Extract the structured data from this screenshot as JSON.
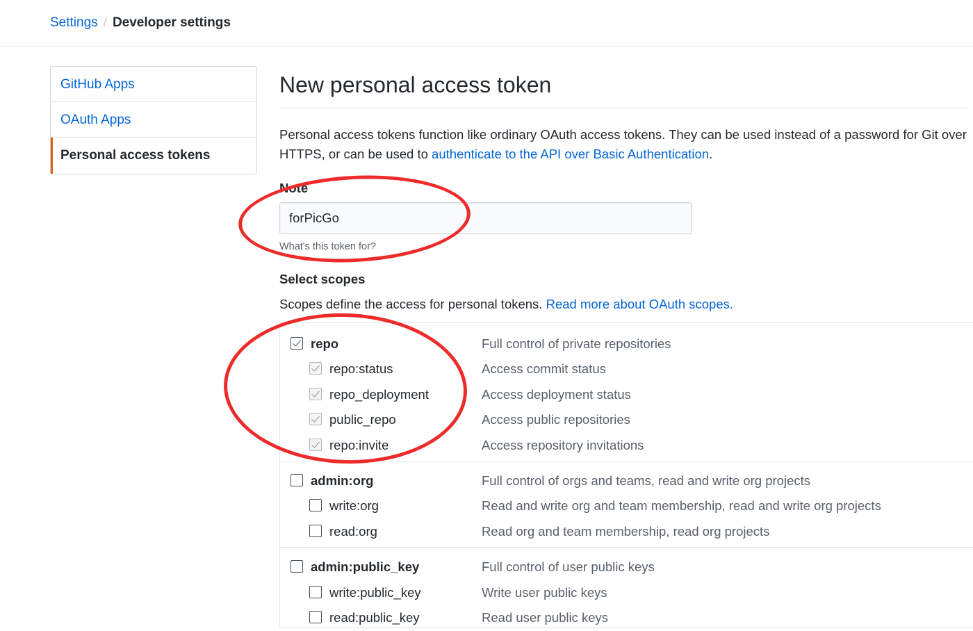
{
  "breadcrumb": {
    "parent": "Settings",
    "separator": "/",
    "current": "Developer settings"
  },
  "sidebar": {
    "items": [
      {
        "label": "GitHub Apps",
        "selected": false
      },
      {
        "label": "OAuth Apps",
        "selected": false
      },
      {
        "label": "Personal access tokens",
        "selected": true
      }
    ]
  },
  "main": {
    "title": "New personal access token",
    "intro_text": "Personal access tokens function like ordinary OAuth access tokens. They can be used instead of a password for Git over HTTPS, or can be used to ",
    "intro_link": "authenticate to the API over Basic Authentication",
    "intro_end": ".",
    "note": {
      "label": "Note",
      "value": "forPicGo",
      "hint": "What's this token for?"
    },
    "scopes": {
      "heading": "Select scopes",
      "desc_text": "Scopes define the access for personal tokens. ",
      "desc_link": "Read more about OAuth scopes.",
      "groups": [
        {
          "name": "repo",
          "desc": "Full control of private repositories",
          "checked": true,
          "children": [
            {
              "name": "repo:status",
              "desc": "Access commit status",
              "checked": true
            },
            {
              "name": "repo_deployment",
              "desc": "Access deployment status",
              "checked": true
            },
            {
              "name": "public_repo",
              "desc": "Access public repositories",
              "checked": true
            },
            {
              "name": "repo:invite",
              "desc": "Access repository invitations",
              "checked": true
            }
          ]
        },
        {
          "name": "admin:org",
          "desc": "Full control of orgs and teams, read and write org projects",
          "checked": false,
          "children": [
            {
              "name": "write:org",
              "desc": "Read and write org and team membership, read and write org projects",
              "checked": false
            },
            {
              "name": "read:org",
              "desc": "Read org and team membership, read org projects",
              "checked": false
            }
          ]
        },
        {
          "name": "admin:public_key",
          "desc": "Full control of user public keys",
          "checked": false,
          "children": [
            {
              "name": "write:public_key",
              "desc": "Write user public keys",
              "checked": false
            },
            {
              "name": "read:public_key",
              "desc": "Read user public keys",
              "checked": false
            }
          ]
        }
      ]
    }
  },
  "colors": {
    "link": "#0366d6",
    "text": "#24292e",
    "muted": "#586069",
    "selected_accent": "#e36209",
    "annotation": "#ee2b2b"
  }
}
